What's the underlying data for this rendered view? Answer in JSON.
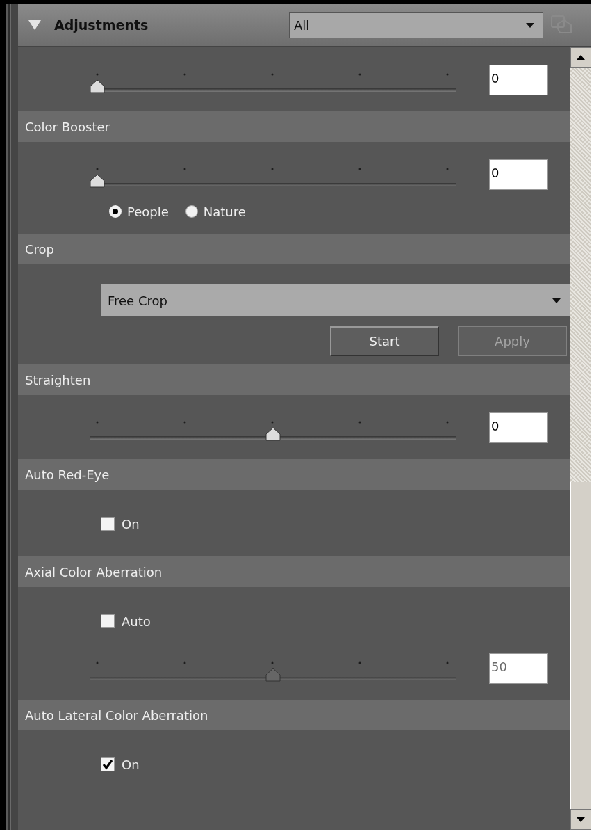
{
  "header": {
    "title": "Adjustments",
    "expanded": true,
    "filter": "All"
  },
  "sections": [
    {
      "items": [
        {
          "kind": "slider",
          "level": 0,
          "value": "0",
          "disabled": false
        }
      ]
    },
    {
      "title": "Color Booster",
      "items": [
        {
          "kind": "slider",
          "level": 0,
          "value": "0",
          "disabled": false
        },
        {
          "kind": "radios",
          "options": [
            {
              "label": "People",
              "selected": true
            },
            {
              "label": "Nature",
              "selected": false
            }
          ]
        }
      ]
    },
    {
      "title": "Crop",
      "items": [
        {
          "kind": "dropdown",
          "value": "Free Crop"
        },
        {
          "kind": "buttons",
          "buttons": [
            {
              "label": "Start",
              "disabled": false
            },
            {
              "label": "Apply",
              "disabled": true
            }
          ]
        }
      ]
    },
    {
      "title": "Straighten",
      "items": [
        {
          "kind": "slider",
          "level": 0.5,
          "value": "0",
          "disabled": false
        }
      ]
    },
    {
      "title": "Auto Red-Eye",
      "items": [
        {
          "kind": "checkbox",
          "label": "On",
          "checked": false
        }
      ]
    },
    {
      "title": "Axial Color Aberration",
      "items": [
        {
          "kind": "checkbox",
          "label": "Auto",
          "checked": false
        },
        {
          "kind": "slider",
          "level": 0.5,
          "value": "50",
          "disabled": true
        }
      ]
    },
    {
      "title": "Auto Lateral Color Aberration",
      "items": [
        {
          "kind": "checkbox",
          "label": "On",
          "checked": true
        }
      ]
    }
  ]
}
